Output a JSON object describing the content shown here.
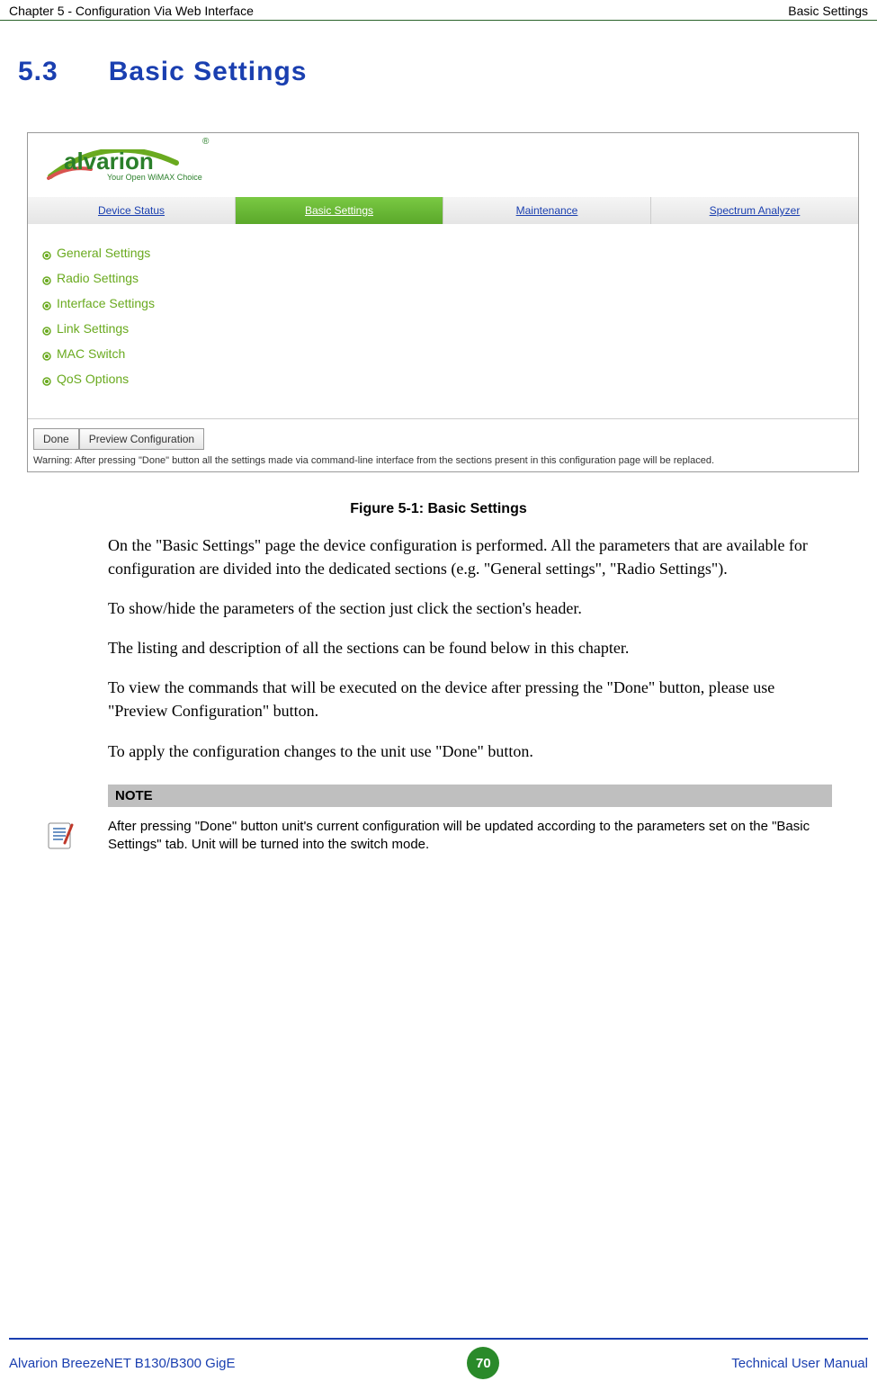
{
  "header": {
    "left": "Chapter 5 - Configuration Via Web Interface",
    "right": "Basic Settings"
  },
  "section": {
    "number": "5.3",
    "title": "Basic Settings"
  },
  "figure": {
    "logo": {
      "name": "alvarion",
      "tag": "Your Open WiMAX Choice",
      "reg": "®"
    },
    "nav": [
      {
        "label": "Device Status",
        "active": false
      },
      {
        "label": "Basic Settings",
        "active": true
      },
      {
        "label": "Maintenance",
        "active": false
      },
      {
        "label": "Spectrum Analyzer",
        "active": false
      }
    ],
    "side_items": [
      "General Settings",
      "Radio Settings",
      "Interface Settings",
      "Link Settings",
      "MAC Switch",
      "QoS Options"
    ],
    "buttons": {
      "done": "Done",
      "preview": "Preview Configuration"
    },
    "warning": "Warning: After pressing \"Done\" button all the settings made via command-line interface from the sections present in this configuration page will be replaced."
  },
  "caption": "Figure 5-1: Basic Settings",
  "paragraphs": [
    "On the \"Basic Settings\" page the device configuration is performed. All the parameters that are available for configuration are divided into the dedicated sections (e.g. \"General settings\", \"Radio Settings\").",
    "To show/hide the parameters of the section just click the section's header.",
    "The listing and description of all the sections can be found below in this chapter.",
    "To view the commands that will be executed on the device after pressing the \"Done\" button, please use \"Preview Configuration\" button.",
    "To apply the configuration changes to the unit use \"Done\" button."
  ],
  "note": {
    "header": "NOTE",
    "body": "After pressing \"Done\" button unit's current configuration will be updated according to the parameters set on the \"Basic Settings\" tab. Unit will be turned into the switch mode."
  },
  "footer": {
    "left": "Alvarion BreezeNET B130/B300 GigE",
    "page": "70",
    "right": "Technical User Manual"
  }
}
